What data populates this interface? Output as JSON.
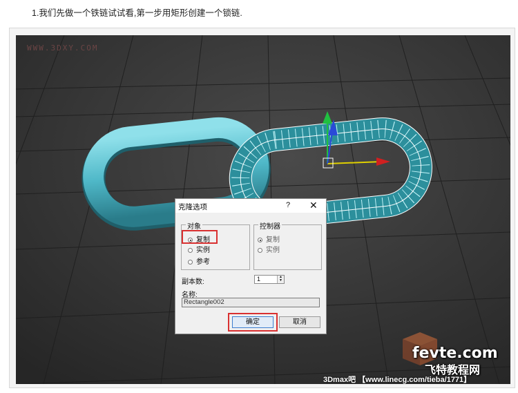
{
  "caption": "1.我们先做一个铁链试试看,第一步用矩形创建一个锁链.",
  "watermarks": {
    "top_left": "WWW.3DXY.COM",
    "logo_main": "fevte.com",
    "logo_sub": "飞特教程网",
    "bottom": "3Dmax吧 【www.linecg.com/tieba/1771】"
  },
  "colors": {
    "viewport_bg": "#3a3a3a",
    "chain_link": "#4fb8c8",
    "highlight": "#d93030"
  },
  "dialog": {
    "title": "克隆选项",
    "help_glyph": "?",
    "close_glyph": "✕",
    "object_group": {
      "legend": "对象",
      "options": [
        {
          "label": "复制",
          "selected": true
        },
        {
          "label": "实例",
          "selected": false
        },
        {
          "label": "参考",
          "selected": false
        }
      ]
    },
    "controller_group": {
      "legend": "控制器",
      "options": [
        {
          "label": "复制",
          "selected": true
        },
        {
          "label": "实例",
          "selected": false
        }
      ]
    },
    "copies_label": "副本数:",
    "copies_value": "1",
    "name_label": "名称:",
    "name_value": "Rectangle002",
    "ok_label": "确定",
    "cancel_label": "取消"
  }
}
